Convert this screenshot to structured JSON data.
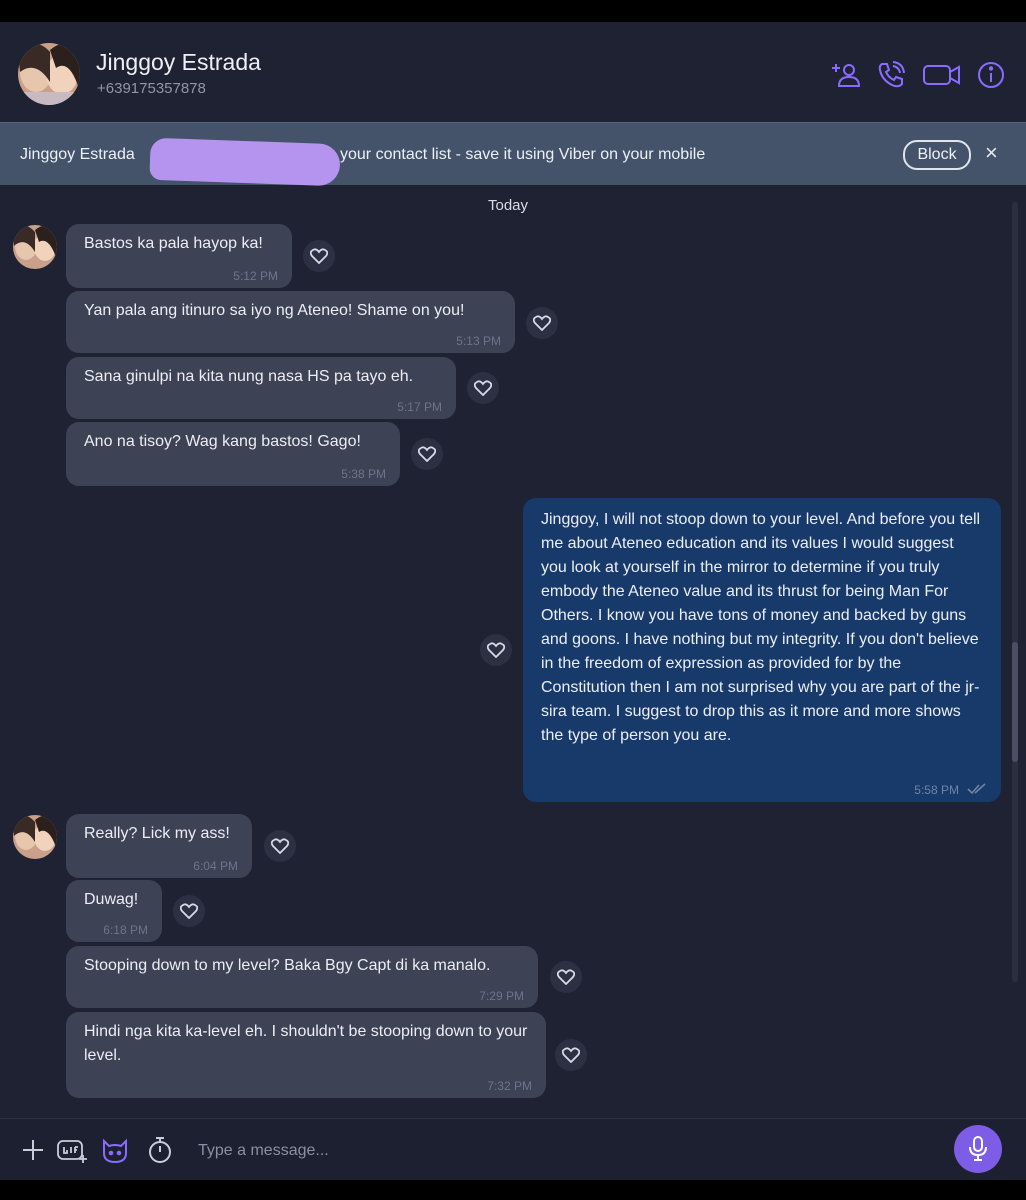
{
  "header": {
    "contact_name": "Jinggoy Estrada",
    "contact_phone": "+639175357878"
  },
  "banner": {
    "name": "Jinggoy Estrada",
    "text": "your contact list - save it using Viber on your mobile",
    "block_label": "Block",
    "close_label": "×"
  },
  "date_divider": "Today",
  "messages": [
    {
      "text": "Bastos ka pala hayop ka!",
      "time": "5:12 PM",
      "direction": "in"
    },
    {
      "text": "Yan pala ang itinuro sa iyo ng Ateneo! Shame on you!",
      "time": "5:13 PM",
      "direction": "in"
    },
    {
      "text": "Sana ginulpi na kita nung nasa HS pa tayo eh.",
      "time": "5:17 PM",
      "direction": "in"
    },
    {
      "text": "Ano na tisoy? Wag kang bastos! Gago!",
      "time": "5:38 PM",
      "direction": "in"
    },
    {
      "text": "Jinggoy, I will not stoop down to your level. And before you tell me about Ateneo education and its values I would suggest you look at yourself in the mirror to determine if you truly embody the Ateneo value and its thrust for being Man For Others. I know you have tons of money and backed by guns and goons. I have nothing but my integrity. If you don't believe in the freedom of expression as provided for by the Constitution then I am not surprised why you are part of the jr-sira team. I suggest to drop this as it more and more shows the type of person you are.",
      "time": "5:58 PM",
      "direction": "out"
    },
    {
      "text": "Really? Lick my ass!",
      "time": "6:04 PM",
      "direction": "in"
    },
    {
      "text": "Duwag!",
      "time": "6:18 PM",
      "direction": "in"
    },
    {
      "text": "Stooping down to my level? Baka Bgy Capt di ka manalo.",
      "time": "7:29 PM",
      "direction": "in"
    },
    {
      "text": "Hindi nga kita ka-level eh. I shouldn't be stooping down to your level.",
      "time": "7:32 PM",
      "direction": "in"
    }
  ],
  "composer": {
    "placeholder": "Type a message..."
  },
  "icons": {
    "add_contact": "add-contact-icon",
    "call": "phone-call-icon",
    "video": "video-call-icon",
    "info": "info-icon",
    "plus": "plus-icon",
    "gif": "gif-icon",
    "sticker": "sticker-icon",
    "timer": "timer-icon",
    "mic": "microphone-icon",
    "heart": "heart-icon",
    "read": "double-check-icon"
  },
  "colors": {
    "background": "#1f2232",
    "incoming_bubble": "#3d4255",
    "outgoing_bubble": "#173a6b",
    "accent": "#7d5ce6",
    "banner": "#44536a"
  }
}
